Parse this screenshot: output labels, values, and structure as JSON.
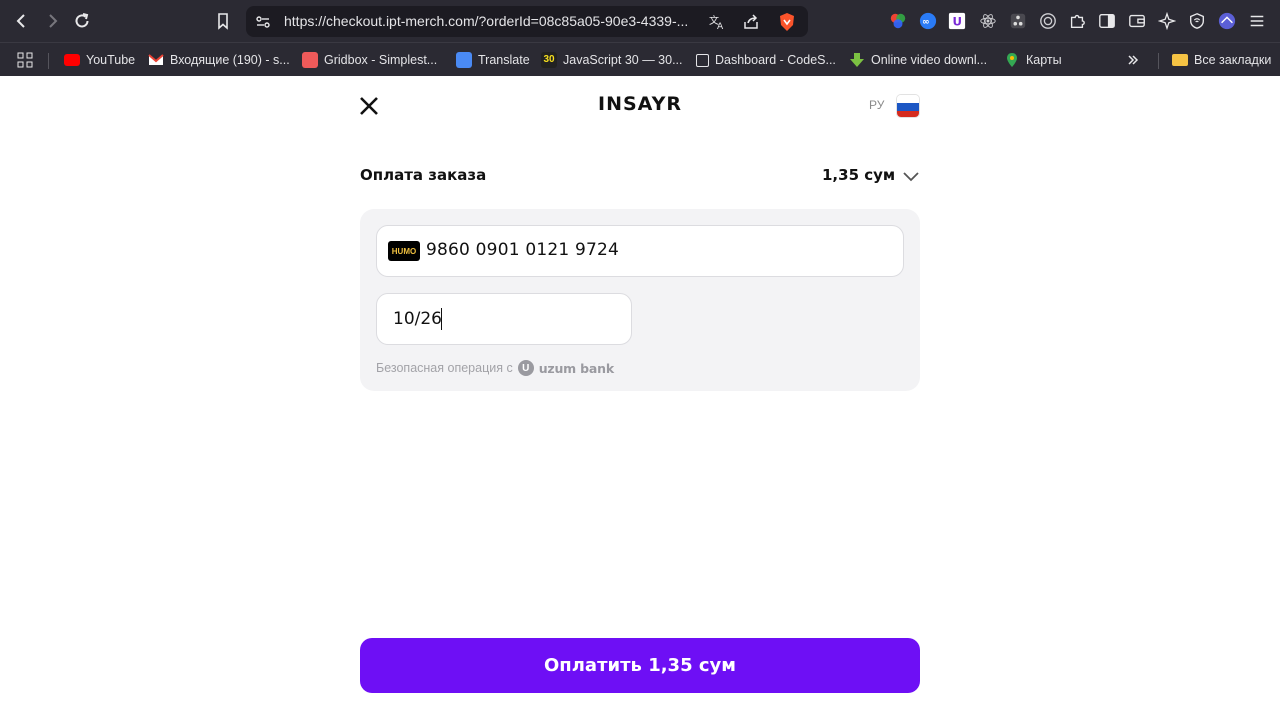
{
  "browser": {
    "url": "https://checkout.ipt-merch.com/?orderId=08c85a05-90e3-4339-...",
    "bookmarks": [
      {
        "label": "YouTube",
        "color": "#ff0000"
      },
      {
        "label": "Входящие (190) - s...",
        "color": "#ea4335"
      },
      {
        "label": "Gridbox - Simplest...",
        "color": "#ef5a5a"
      },
      {
        "label": "Translate",
        "color": "#4a8af4"
      },
      {
        "label": "JavaScript 30 — 30...",
        "color": "#f7df1e"
      },
      {
        "label": "Dashboard - CodeS...",
        "color": "#ffffff"
      },
      {
        "label": "Online video downl...",
        "color": "#7cc142"
      },
      {
        "label": "Карты",
        "color": "#34a853"
      }
    ],
    "all_bookmarks_label": "Все закладки"
  },
  "header": {
    "brand": "INSAYR",
    "lang": "РУ",
    "flag_colors": [
      "#ffffff",
      "#1c57c4",
      "#d52b1e"
    ]
  },
  "order": {
    "label": "Оплата заказа",
    "amount": "1,35 сум"
  },
  "card": {
    "system": "HUMO",
    "number": "9860 0901 0121 9724",
    "expiry": "10/26",
    "secure_text": "Безопасная операция с",
    "bank_name": "uzum bank"
  },
  "pay_button": {
    "label": "Оплатить 1,35 сум",
    "color": "#6e0ff5"
  }
}
